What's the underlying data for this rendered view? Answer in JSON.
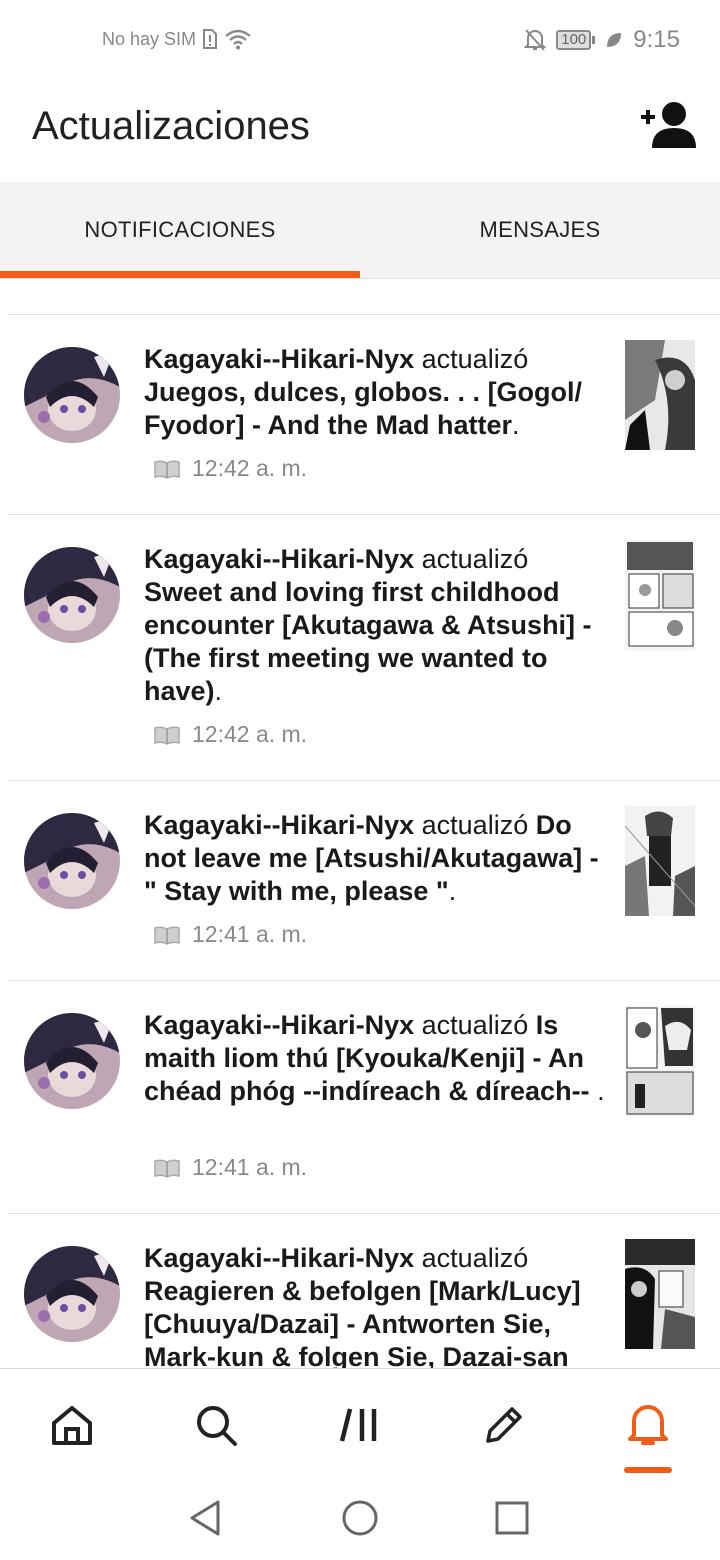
{
  "status_bar": {
    "carrier": "No hay SIM",
    "battery": "100",
    "time": "9:15"
  },
  "header": {
    "title": "Actualizaciones"
  },
  "tabs": [
    {
      "label": "NOTIFICACIONES",
      "active": true
    },
    {
      "label": "MENSAJES",
      "active": false
    }
  ],
  "notifications": [
    {
      "author": "Kagayaki--Hikari-Nyx",
      "action": "actualizó",
      "story": "Juegos, dulces, globos. . . [Gogol/ Fyodor] - And the Mad hatter",
      "trail": ".",
      "time": "12:42 a. m."
    },
    {
      "author": "Kagayaki--Hikari-Nyx",
      "action": "actualizó",
      "story": "Sweet and loving first childhood encounter [Akutagawa & Atsushi] - (The first meeting we wanted to have)",
      "trail": ".",
      "time": "12:42 a. m."
    },
    {
      "author": "Kagayaki--Hikari-Nyx",
      "action": "actualizó",
      "story": "Do not leave me [Atsushi/Akutagawa] - \" Stay with me, please \"",
      "trail": ".",
      "time": "12:41 a. m."
    },
    {
      "author": "Kagayaki--Hikari-Nyx",
      "action": "actualizó",
      "story": "Is maith liom thú [Kyouka/Kenji] - An chéad phóg --indíreach & díreach--",
      "trail": " .",
      "time": "12:41 a. m."
    },
    {
      "author": "Kagayaki--Hikari-Nyx",
      "action": "actualizó",
      "story": "Reagieren & befolgen [Mark/Lucy] [Chuuya/Dazai] - Antworten Sie, Mark-kun & folgen Sie, Dazai-san",
      "trail": "",
      "time": ""
    }
  ],
  "icons": {
    "add_follow": "add-person-icon",
    "nav": [
      "home-icon",
      "search-icon",
      "library-icon",
      "write-icon",
      "bell-icon"
    ]
  },
  "colors": {
    "accent": "#f25c19",
    "text": "#1a1a1a",
    "muted": "#888888"
  }
}
